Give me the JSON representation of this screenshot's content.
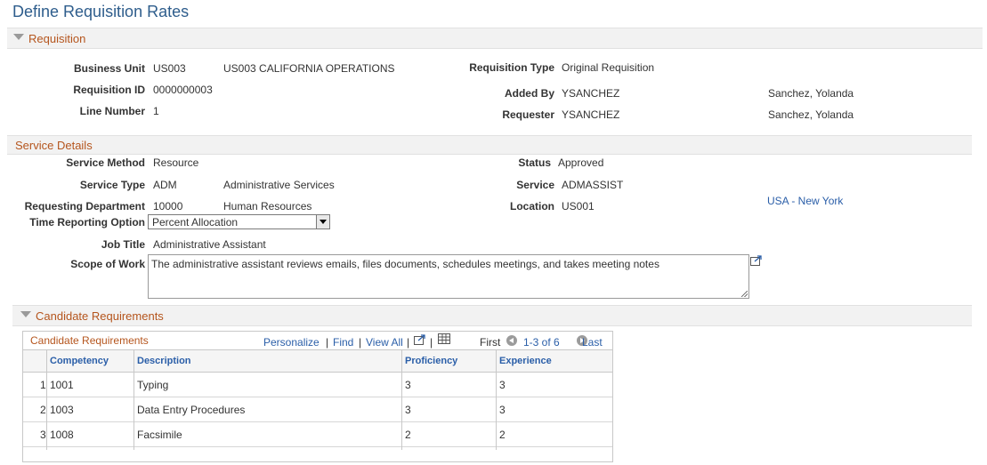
{
  "page_title": "Define Requisition Rates",
  "requisition": {
    "section_title": "Requisition",
    "business_unit_label": "Business Unit",
    "business_unit": "US003",
    "business_unit_desc": "US003 CALIFORNIA OPERATIONS",
    "requisition_type_label": "Requisition Type",
    "requisition_type": "Original Requisition",
    "requisition_id_label": "Requisition ID",
    "requisition_id": "0000000003",
    "added_by_label": "Added By",
    "added_by": "YSANCHEZ",
    "added_by_name": "Sanchez, Yolanda",
    "line_number_label": "Line Number",
    "line_number": "1",
    "requester_label": "Requester",
    "requester": "YSANCHEZ",
    "requester_name": "Sanchez, Yolanda"
  },
  "service": {
    "section_title": "Service Details",
    "service_method_label": "Service Method",
    "service_method": "Resource",
    "status_label": "Status",
    "status": "Approved",
    "service_type_label": "Service Type",
    "service_type": "ADM",
    "service_type_desc": "Administrative Services",
    "service_label": "Service",
    "service": "ADMASSIST",
    "req_dept_label": "Requesting Department",
    "req_dept": "10000",
    "req_dept_desc": "Human Resources",
    "location_label": "Location",
    "location": "US001",
    "location_link": "USA - New York",
    "time_option_label": "Time Reporting Option",
    "time_option": "Percent Allocation",
    "job_title_label": "Job Title",
    "job_title": "Administrative Assistant",
    "scope_label": "Scope of Work",
    "scope": "The administrative assistant reviews emails, files documents, schedules meetings, and takes meeting notes"
  },
  "candidate": {
    "section_title": "Candidate Requirements",
    "grid_title": "Candidate Requirements",
    "personalize": "Personalize",
    "find": "Find",
    "view_all": "View All",
    "first": "First",
    "range": "1-3 of 6",
    "last": "Last",
    "columns": {
      "competency": "Competency",
      "description": "Description",
      "proficiency": "Proficiency",
      "experience": "Experience"
    },
    "rows": [
      {
        "num": "1",
        "competency": "1001",
        "description": "Typing",
        "proficiency": "3",
        "experience": "3"
      },
      {
        "num": "2",
        "competency": "1003",
        "description": "Data Entry Procedures",
        "proficiency": "3",
        "experience": "3"
      },
      {
        "num": "3",
        "competency": "1008",
        "description": "Facsimile",
        "proficiency": "2",
        "experience": "2"
      }
    ]
  }
}
